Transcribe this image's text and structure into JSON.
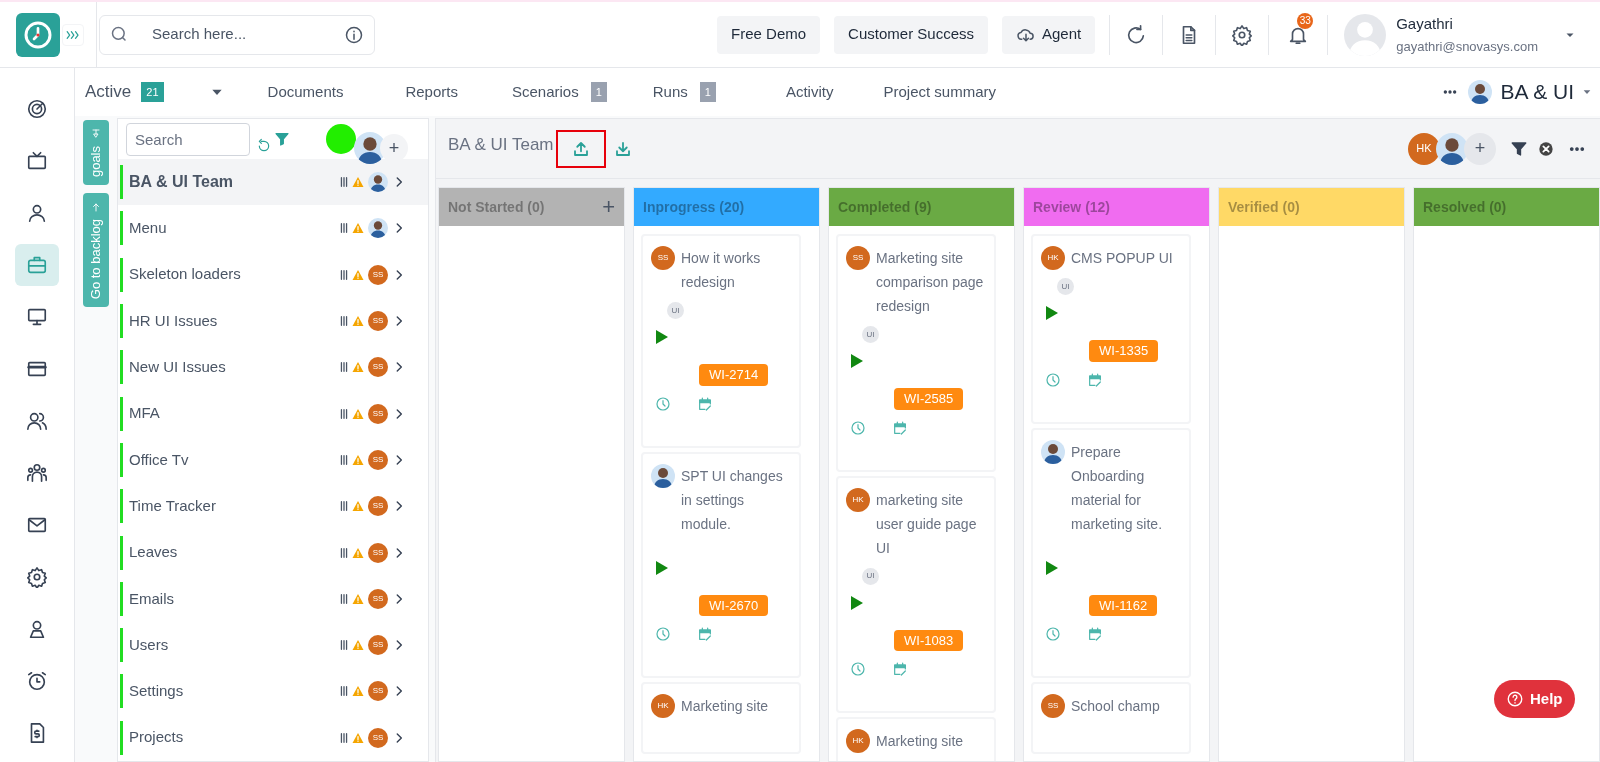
{
  "header": {
    "search_placeholder": "Search here...",
    "buttons": [
      {
        "label": "Free Demo",
        "kind": "plain"
      },
      {
        "label": "Customer Success",
        "kind": "plain"
      },
      {
        "label": "Agent",
        "kind": "cloud"
      }
    ],
    "notification_count": "33",
    "user": {
      "name": "Gayathri",
      "email": "gayathri@snovasys.com"
    }
  },
  "nav_rail": [
    {
      "selected": false
    },
    {
      "selected": false
    },
    {
      "selected": false
    },
    {
      "selected": true
    },
    {
      "selected": false
    },
    {
      "selected": false
    },
    {
      "selected": false
    },
    {
      "selected": false
    },
    {
      "selected": false
    },
    {
      "selected": false
    },
    {
      "selected": false
    },
    {
      "selected": false
    },
    {
      "selected": false
    }
  ],
  "tabs": [
    {
      "label": "Active",
      "count": "21",
      "kind": "filter"
    },
    {
      "label": "Documents",
      "kind": "tab"
    },
    {
      "label": "Reports",
      "kind": "tab"
    },
    {
      "label": "Scenarios",
      "count": "1",
      "kind": "tab"
    },
    {
      "label": "Runs",
      "count": "1",
      "kind": "tab"
    },
    {
      "label": "Activity",
      "kind": "tab"
    },
    {
      "label": "Project summary",
      "kind": "tab"
    }
  ],
  "project_switcher": {
    "label": "BA & UI"
  },
  "side_tabs": [
    {
      "label": "goals",
      "kind": "pin"
    },
    {
      "label": "Go to backlog",
      "kind": "back"
    }
  ],
  "project_list": {
    "search_placeholder": "Search",
    "add_member_label": "+",
    "items": [
      {
        "name": "BA & UI Team",
        "selected": true,
        "avatar": {
          "kind": "photo"
        }
      },
      {
        "name": "Menu",
        "selected": false,
        "avatar": {
          "kind": "photo"
        }
      },
      {
        "name": "Skeleton loaders",
        "selected": false,
        "avatar": {
          "kind": "initials",
          "text": "SS"
        }
      },
      {
        "name": "HR UI Issues",
        "selected": false,
        "avatar": {
          "kind": "initials",
          "text": "SS"
        }
      },
      {
        "name": "New UI Issues",
        "selected": false,
        "avatar": {
          "kind": "initials",
          "text": "SS"
        }
      },
      {
        "name": "MFA",
        "selected": false,
        "avatar": {
          "kind": "initials",
          "text": "SS"
        }
      },
      {
        "name": "Office Tv",
        "selected": false,
        "avatar": {
          "kind": "initials",
          "text": "SS"
        }
      },
      {
        "name": "Time Tracker",
        "selected": false,
        "avatar": {
          "kind": "initials",
          "text": "SS"
        }
      },
      {
        "name": "Leaves",
        "selected": false,
        "avatar": {
          "kind": "initials",
          "text": "SS"
        }
      },
      {
        "name": "Emails",
        "selected": false,
        "avatar": {
          "kind": "initials",
          "text": "SS"
        }
      },
      {
        "name": "Users",
        "selected": false,
        "avatar": {
          "kind": "initials",
          "text": "SS"
        }
      },
      {
        "name": "Settings",
        "selected": false,
        "avatar": {
          "kind": "initials",
          "text": "SS"
        }
      },
      {
        "name": "Projects",
        "selected": false,
        "avatar": {
          "kind": "initials",
          "text": "SS"
        }
      }
    ]
  },
  "board": {
    "title": "BA & UI Team",
    "upload_highlighted": true,
    "members": [
      {
        "kind": "initials",
        "text": "HK"
      },
      {
        "kind": "photo"
      }
    ],
    "add_member_label": "+",
    "columns": [
      {
        "title": "Not Started (0)",
        "color": "#b3b3b3",
        "add_label": "+"
      },
      {
        "title": "Inprogress (20)",
        "color": "#33aaff",
        "cards": [
          {
            "assignee": {
              "kind": "initials",
              "text": "SS"
            },
            "title": "How it works redesign",
            "tag": "UI",
            "id": "WI-2714"
          },
          {
            "assignee": {
              "kind": "photo"
            },
            "title": "SPT UI changes in settings module.",
            "id": "WI-2670"
          },
          {
            "assignee": {
              "kind": "initials",
              "text": "HK"
            },
            "title": "Marketing site"
          }
        ]
      },
      {
        "title": "Completed (9)",
        "color": "#6aaa44",
        "cards": [
          {
            "assignee": {
              "kind": "initials",
              "text": "SS"
            },
            "title": "Marketing site comparison page redesign",
            "tag": "UI",
            "id": "WI-2585"
          },
          {
            "assignee": {
              "kind": "initials",
              "text": "HK"
            },
            "title": "marketing site user guide page UI",
            "tag": "UI",
            "id": "WI-1083"
          },
          {
            "assignee": {
              "kind": "initials",
              "text": "HK"
            },
            "title": "Marketing site"
          }
        ]
      },
      {
        "title": "Review (12)",
        "color": "#f06cf0",
        "cards": [
          {
            "assignee": {
              "kind": "initials",
              "text": "HK"
            },
            "title": "CMS POPUP UI",
            "tag": "UI",
            "id": "WI-1335"
          },
          {
            "assignee": {
              "kind": "photo"
            },
            "title": "Prepare Onboarding material for marketing site.",
            "id": "WI-1162"
          },
          {
            "assignee": {
              "kind": "initials",
              "text": "SS"
            },
            "title": "School champ"
          }
        ]
      },
      {
        "title": "Verified (0)",
        "color": "#ffd966"
      },
      {
        "title": "Resolved (0)",
        "color": "#6aaa44"
      }
    ]
  },
  "help_button": {
    "label": "Help"
  }
}
